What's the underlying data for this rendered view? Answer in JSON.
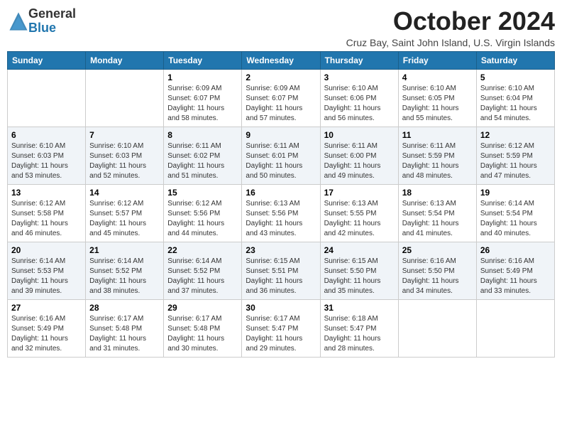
{
  "logo": {
    "general": "General",
    "blue": "Blue"
  },
  "header": {
    "month_title": "October 2024",
    "location": "Cruz Bay, Saint John Island, U.S. Virgin Islands"
  },
  "days_of_week": [
    "Sunday",
    "Monday",
    "Tuesday",
    "Wednesday",
    "Thursday",
    "Friday",
    "Saturday"
  ],
  "weeks": [
    [
      {
        "day": "",
        "sunrise": "",
        "sunset": "",
        "daylight": ""
      },
      {
        "day": "",
        "sunrise": "",
        "sunset": "",
        "daylight": ""
      },
      {
        "day": "1",
        "sunrise": "Sunrise: 6:09 AM",
        "sunset": "Sunset: 6:07 PM",
        "daylight": "Daylight: 11 hours and 58 minutes."
      },
      {
        "day": "2",
        "sunrise": "Sunrise: 6:09 AM",
        "sunset": "Sunset: 6:07 PM",
        "daylight": "Daylight: 11 hours and 57 minutes."
      },
      {
        "day": "3",
        "sunrise": "Sunrise: 6:10 AM",
        "sunset": "Sunset: 6:06 PM",
        "daylight": "Daylight: 11 hours and 56 minutes."
      },
      {
        "day": "4",
        "sunrise": "Sunrise: 6:10 AM",
        "sunset": "Sunset: 6:05 PM",
        "daylight": "Daylight: 11 hours and 55 minutes."
      },
      {
        "day": "5",
        "sunrise": "Sunrise: 6:10 AM",
        "sunset": "Sunset: 6:04 PM",
        "daylight": "Daylight: 11 hours and 54 minutes."
      }
    ],
    [
      {
        "day": "6",
        "sunrise": "Sunrise: 6:10 AM",
        "sunset": "Sunset: 6:03 PM",
        "daylight": "Daylight: 11 hours and 53 minutes."
      },
      {
        "day": "7",
        "sunrise": "Sunrise: 6:10 AM",
        "sunset": "Sunset: 6:03 PM",
        "daylight": "Daylight: 11 hours and 52 minutes."
      },
      {
        "day": "8",
        "sunrise": "Sunrise: 6:11 AM",
        "sunset": "Sunset: 6:02 PM",
        "daylight": "Daylight: 11 hours and 51 minutes."
      },
      {
        "day": "9",
        "sunrise": "Sunrise: 6:11 AM",
        "sunset": "Sunset: 6:01 PM",
        "daylight": "Daylight: 11 hours and 50 minutes."
      },
      {
        "day": "10",
        "sunrise": "Sunrise: 6:11 AM",
        "sunset": "Sunset: 6:00 PM",
        "daylight": "Daylight: 11 hours and 49 minutes."
      },
      {
        "day": "11",
        "sunrise": "Sunrise: 6:11 AM",
        "sunset": "Sunset: 5:59 PM",
        "daylight": "Daylight: 11 hours and 48 minutes."
      },
      {
        "day": "12",
        "sunrise": "Sunrise: 6:12 AM",
        "sunset": "Sunset: 5:59 PM",
        "daylight": "Daylight: 11 hours and 47 minutes."
      }
    ],
    [
      {
        "day": "13",
        "sunrise": "Sunrise: 6:12 AM",
        "sunset": "Sunset: 5:58 PM",
        "daylight": "Daylight: 11 hours and 46 minutes."
      },
      {
        "day": "14",
        "sunrise": "Sunrise: 6:12 AM",
        "sunset": "Sunset: 5:57 PM",
        "daylight": "Daylight: 11 hours and 45 minutes."
      },
      {
        "day": "15",
        "sunrise": "Sunrise: 6:12 AM",
        "sunset": "Sunset: 5:56 PM",
        "daylight": "Daylight: 11 hours and 44 minutes."
      },
      {
        "day": "16",
        "sunrise": "Sunrise: 6:13 AM",
        "sunset": "Sunset: 5:56 PM",
        "daylight": "Daylight: 11 hours and 43 minutes."
      },
      {
        "day": "17",
        "sunrise": "Sunrise: 6:13 AM",
        "sunset": "Sunset: 5:55 PM",
        "daylight": "Daylight: 11 hours and 42 minutes."
      },
      {
        "day": "18",
        "sunrise": "Sunrise: 6:13 AM",
        "sunset": "Sunset: 5:54 PM",
        "daylight": "Daylight: 11 hours and 41 minutes."
      },
      {
        "day": "19",
        "sunrise": "Sunrise: 6:14 AM",
        "sunset": "Sunset: 5:54 PM",
        "daylight": "Daylight: 11 hours and 40 minutes."
      }
    ],
    [
      {
        "day": "20",
        "sunrise": "Sunrise: 6:14 AM",
        "sunset": "Sunset: 5:53 PM",
        "daylight": "Daylight: 11 hours and 39 minutes."
      },
      {
        "day": "21",
        "sunrise": "Sunrise: 6:14 AM",
        "sunset": "Sunset: 5:52 PM",
        "daylight": "Daylight: 11 hours and 38 minutes."
      },
      {
        "day": "22",
        "sunrise": "Sunrise: 6:14 AM",
        "sunset": "Sunset: 5:52 PM",
        "daylight": "Daylight: 11 hours and 37 minutes."
      },
      {
        "day": "23",
        "sunrise": "Sunrise: 6:15 AM",
        "sunset": "Sunset: 5:51 PM",
        "daylight": "Daylight: 11 hours and 36 minutes."
      },
      {
        "day": "24",
        "sunrise": "Sunrise: 6:15 AM",
        "sunset": "Sunset: 5:50 PM",
        "daylight": "Daylight: 11 hours and 35 minutes."
      },
      {
        "day": "25",
        "sunrise": "Sunrise: 6:16 AM",
        "sunset": "Sunset: 5:50 PM",
        "daylight": "Daylight: 11 hours and 34 minutes."
      },
      {
        "day": "26",
        "sunrise": "Sunrise: 6:16 AM",
        "sunset": "Sunset: 5:49 PM",
        "daylight": "Daylight: 11 hours and 33 minutes."
      }
    ],
    [
      {
        "day": "27",
        "sunrise": "Sunrise: 6:16 AM",
        "sunset": "Sunset: 5:49 PM",
        "daylight": "Daylight: 11 hours and 32 minutes."
      },
      {
        "day": "28",
        "sunrise": "Sunrise: 6:17 AM",
        "sunset": "Sunset: 5:48 PM",
        "daylight": "Daylight: 11 hours and 31 minutes."
      },
      {
        "day": "29",
        "sunrise": "Sunrise: 6:17 AM",
        "sunset": "Sunset: 5:48 PM",
        "daylight": "Daylight: 11 hours and 30 minutes."
      },
      {
        "day": "30",
        "sunrise": "Sunrise: 6:17 AM",
        "sunset": "Sunset: 5:47 PM",
        "daylight": "Daylight: 11 hours and 29 minutes."
      },
      {
        "day": "31",
        "sunrise": "Sunrise: 6:18 AM",
        "sunset": "Sunset: 5:47 PM",
        "daylight": "Daylight: 11 hours and 28 minutes."
      },
      {
        "day": "",
        "sunrise": "",
        "sunset": "",
        "daylight": ""
      },
      {
        "day": "",
        "sunrise": "",
        "sunset": "",
        "daylight": ""
      }
    ]
  ]
}
